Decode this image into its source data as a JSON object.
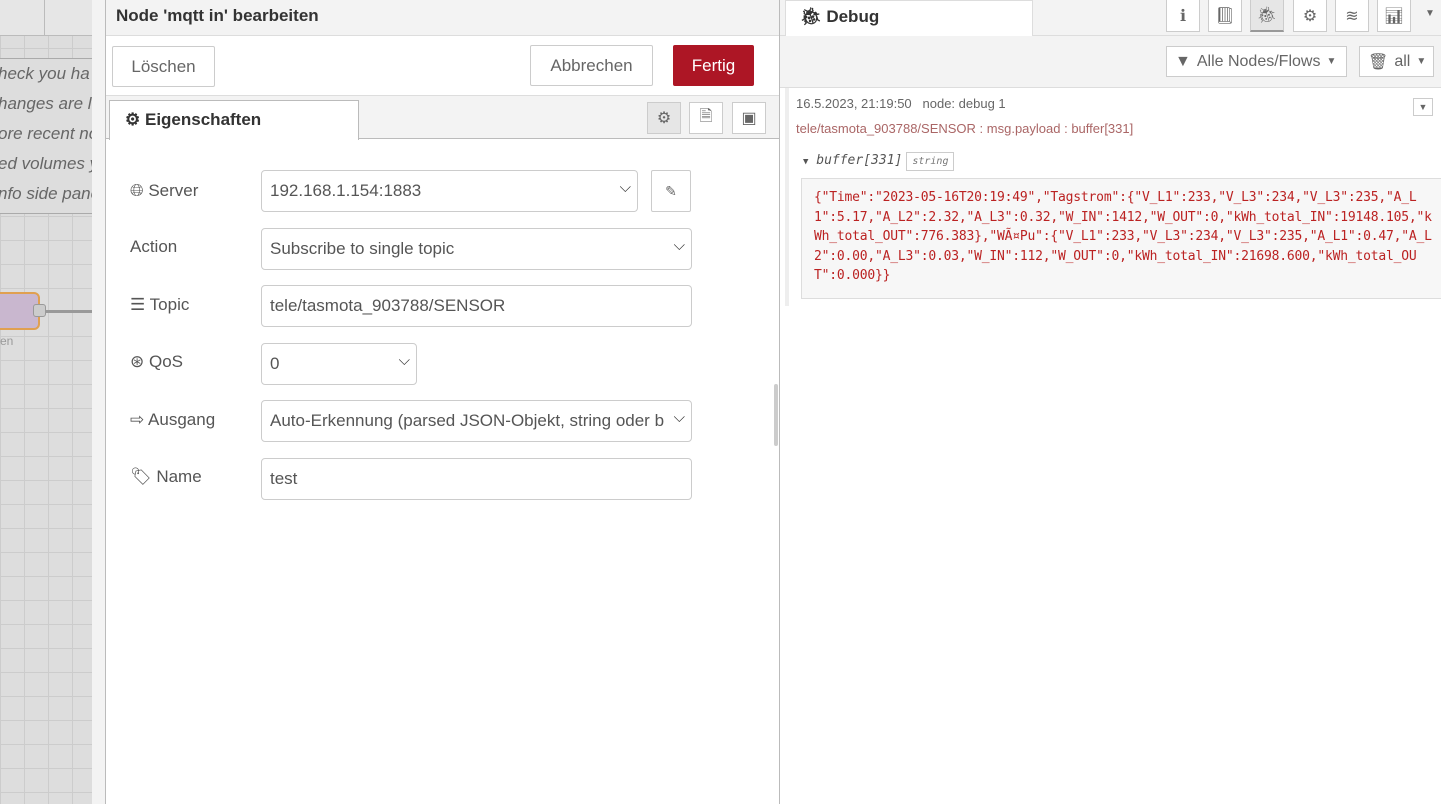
{
  "canvas": {
    "notice_lines": [
      "heck you ha",
      "hanges are l",
      "ore recent no",
      "ed volumes y",
      "nfo side pane"
    ],
    "node_label": "en"
  },
  "editor": {
    "title": "Node 'mqtt in' bearbeiten",
    "delete_label": "Löschen",
    "cancel_label": "Abbrechen",
    "done_label": "Fertig",
    "tab_label": "Eigenschaften",
    "fields": {
      "server_label": "Server",
      "server_value": "192.168.1.154:1883",
      "action_label": "Action",
      "action_value": "Subscribe to single topic",
      "topic_label": "Topic",
      "topic_value": "tele/tasmota_903788/SENSOR",
      "qos_label": "QoS",
      "qos_value": "0",
      "output_label": "Ausgang",
      "output_value": "Auto-Erkennung (parsed JSON-Objekt, string oder b",
      "name_label": "Name",
      "name_value": "test"
    }
  },
  "sidebar": {
    "tab_label": "Debug",
    "filter_label": "Alle Nodes/Flows",
    "clear_label": "all",
    "message": {
      "timestamp": "16.5.2023, 21:19:50",
      "node": "node: debug 1",
      "topic_line": "tele/tasmota_903788/SENSOR : msg.payload : buffer[331]",
      "tree_label": "buffer[331]",
      "type_badge": "string",
      "payload": "{\"Time\":\"2023-05-16T20:19:49\",\"Tagstrom\":{\"V_L1\":233,\"V_L3\":234,\"V_L3\":235,\"A_L1\":5.17,\"A_L2\":2.32,\"A_L3\":0.32,\"W_IN\":1412,\"W_OUT\":0,\"kWh_total_IN\":19148.105,\"kWh_total_OUT\":776.383},\"WÃ¤Pu\":{\"V_L1\":233,\"V_L3\":234,\"V_L3\":235,\"A_L1\":0.47,\"A_L2\":0.00,\"A_L3\":0.03,\"W_IN\":112,\"W_OUT\":0,\"kWh_total_IN\":21698.600,\"kWh_total_OUT\":0.000}}"
    }
  },
  "colors": {
    "primary": "#ad1625",
    "payload_text": "#b22222",
    "topic_text": "#aa6666"
  }
}
